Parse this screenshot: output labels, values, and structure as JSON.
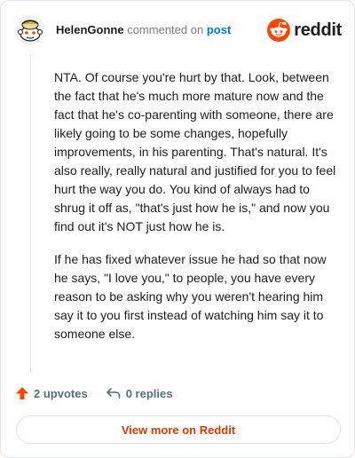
{
  "header": {
    "author": "HelenGonne",
    "action": "commented on",
    "post_link": "post",
    "brand": "reddit",
    "brand_color": "#ff4500"
  },
  "comment": {
    "paragraphs": [
      "NTA. Of course you're hurt by that. Look, between the fact that he's much more mature now and the fact that he's co-parenting with someone, there are likely going to be some changes, hopefully improvements, in his parenting. That's natural. It's also really, really natural and justified for you to feel hurt the way you do. You kind of always had to shrug it off as, \"that's just how he is,\" and now you find out it's NOT just how he is.",
      "If he has fixed whatever issue he had so that now he says, \"I love you,\" to people, you have every reason to be asking why you weren't hearing him say it to you first instead of watching him say it to someone else."
    ]
  },
  "footer": {
    "upvotes": "2 upvotes",
    "replies": "0 replies",
    "upvote_icon": "arrow-up-icon",
    "reply_icon": "reply-arrow-icon"
  },
  "view_more": {
    "label": "View more on Reddit",
    "color": "#d93a00"
  }
}
